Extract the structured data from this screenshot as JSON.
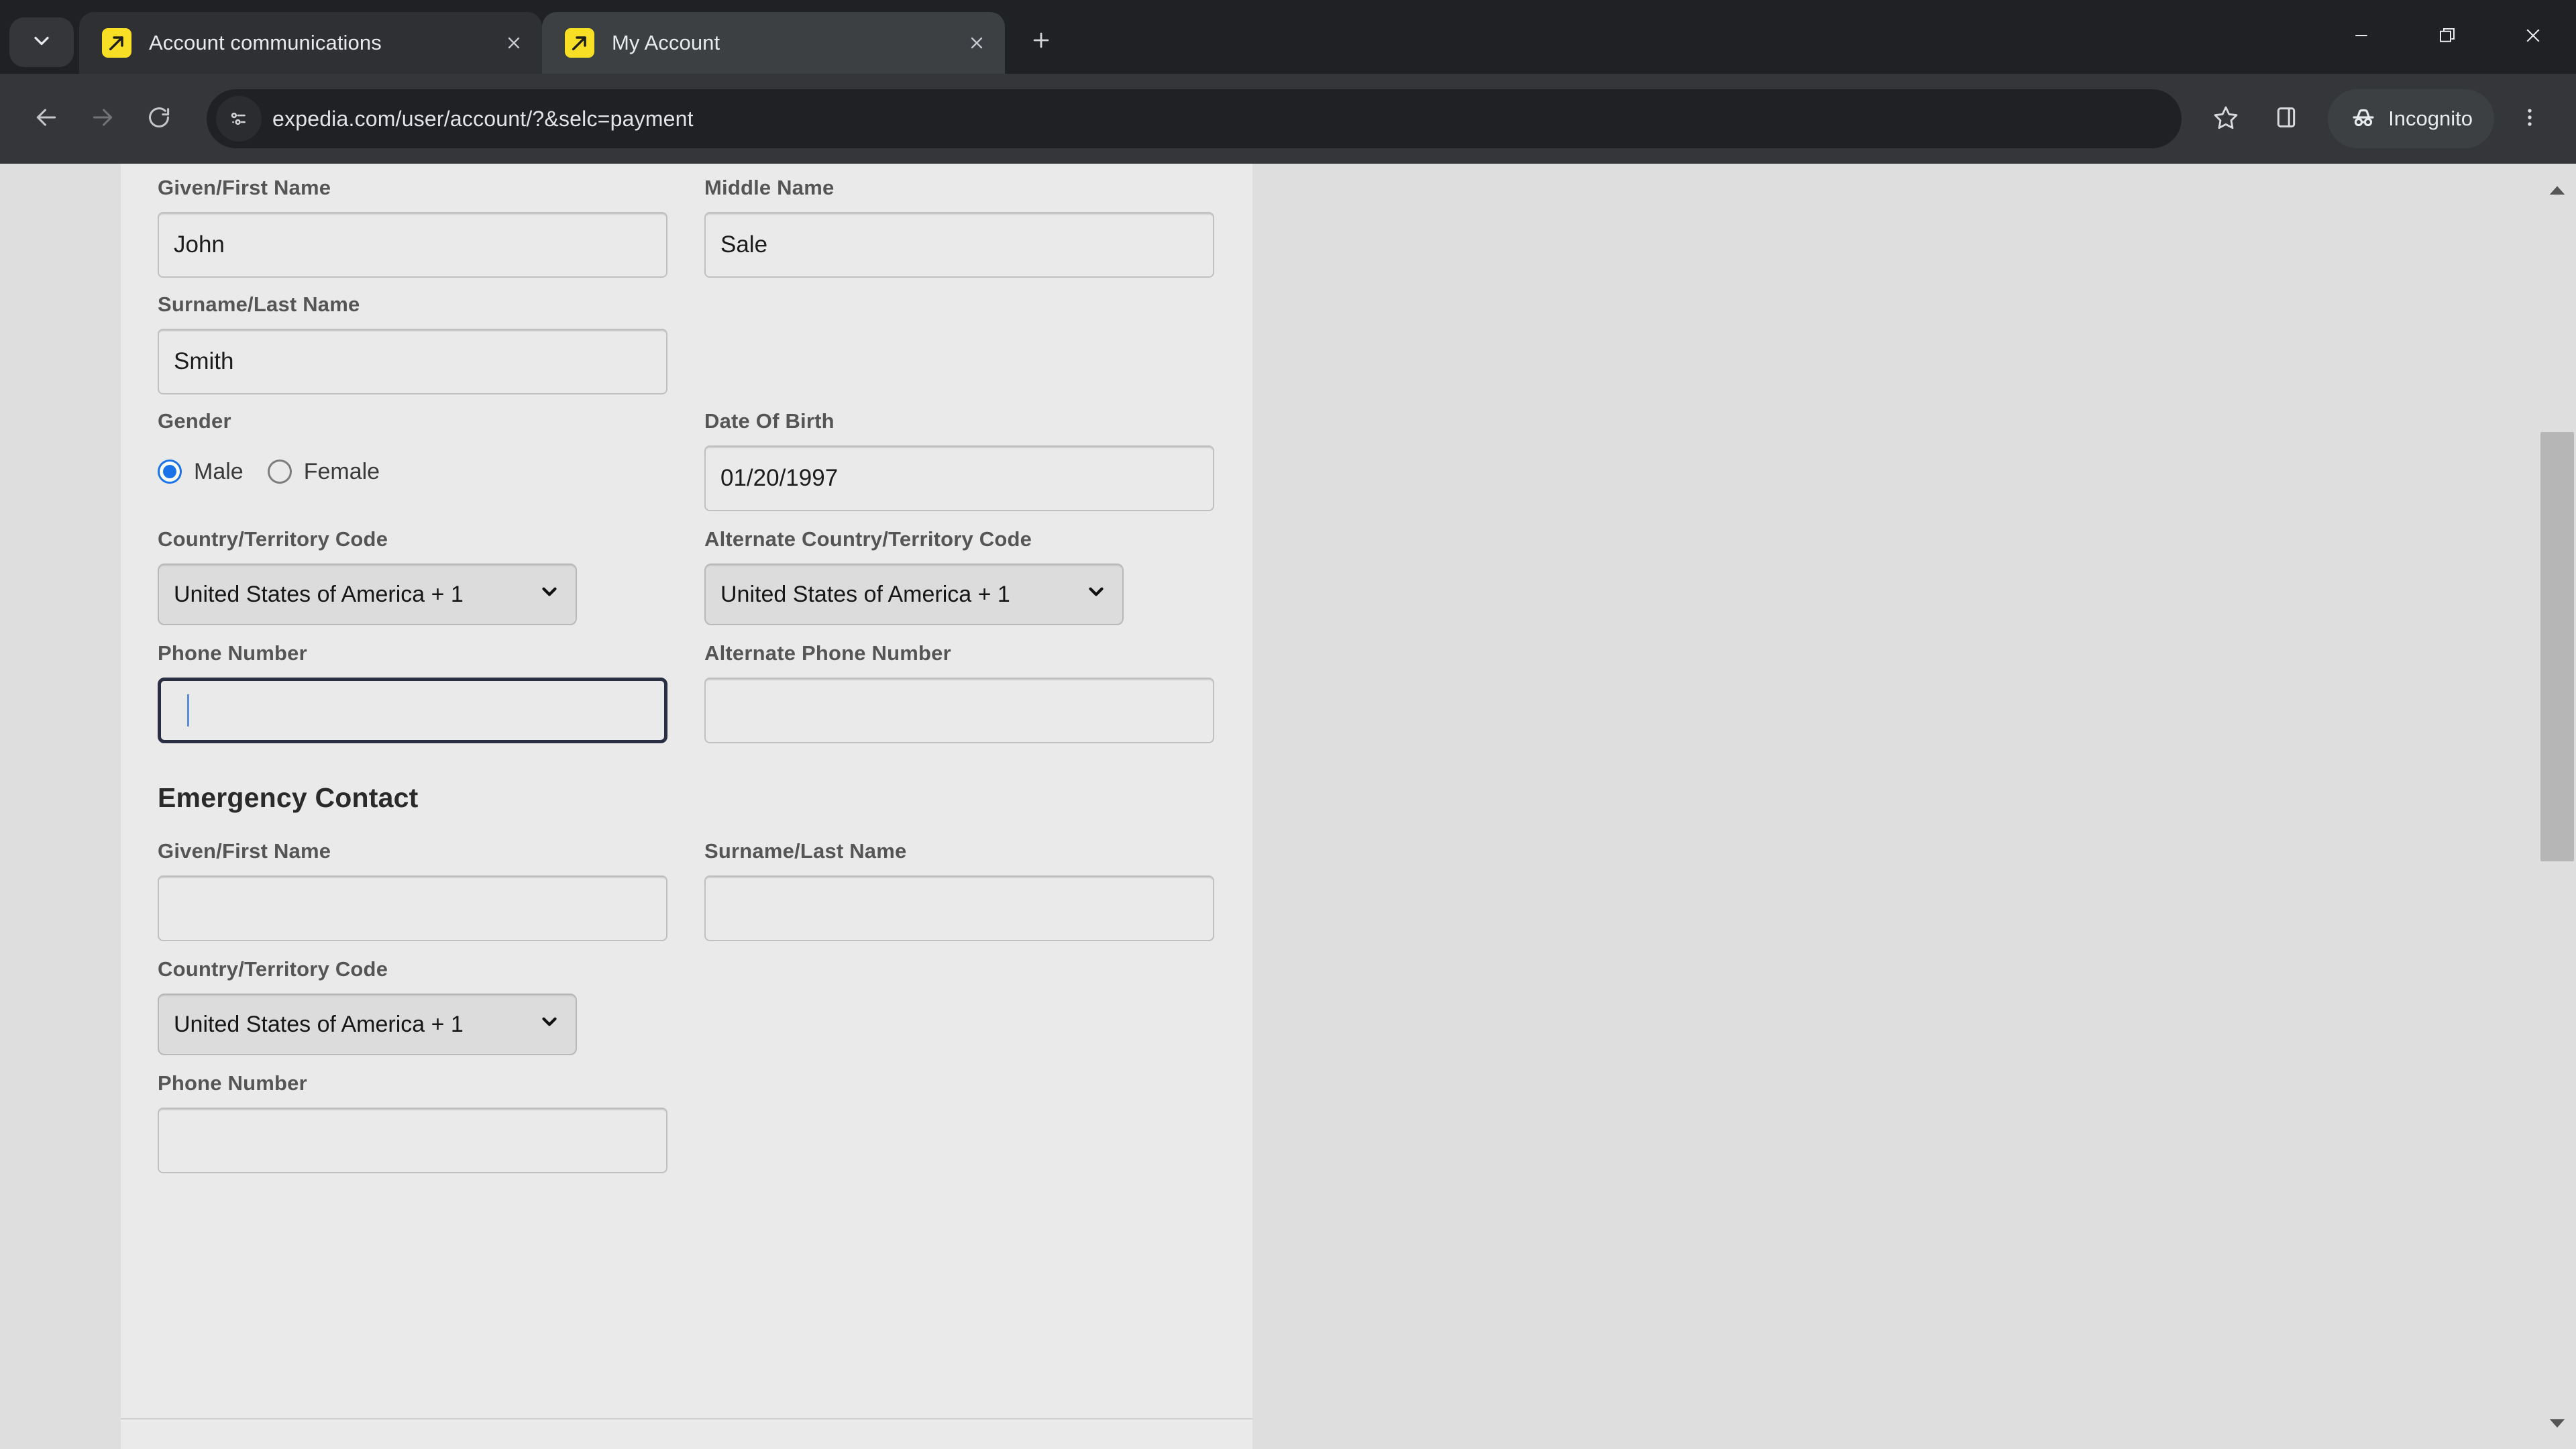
{
  "browser": {
    "tab_search_icon": "chevron-down-icon",
    "tabs": [
      {
        "title": "Account communications",
        "favicon": "expedia-favicon",
        "active": false,
        "close_icon": "close-icon"
      },
      {
        "title": "My Account",
        "favicon": "expedia-favicon",
        "active": true,
        "close_icon": "close-icon"
      }
    ],
    "new_tab_icon": "plus-icon",
    "window_controls": {
      "minimize_icon": "minimize-icon",
      "restore_icon": "restore-icon",
      "close_icon": "close-window-icon"
    },
    "toolbar": {
      "back_icon": "arrow-left-icon",
      "forward_icon": "arrow-right-icon",
      "reload_icon": "reload-icon",
      "site_info_icon": "page-info-icon",
      "url": "expedia.com/user/account/?&selc=payment",
      "url_placeholder": "Search Google or type a URL",
      "bookmark_icon": "star-icon",
      "side_panel_icon": "side-panel-icon",
      "incognito_icon": "incognito-icon",
      "incognito_label": "Incognito",
      "menu_icon": "three-dots-vertical-icon"
    }
  },
  "page": {
    "traveler": {
      "given_name": {
        "label": "Given/First Name",
        "value": "John",
        "placeholder": ""
      },
      "middle_name": {
        "label": "Middle Name",
        "value": "Sale",
        "placeholder": ""
      },
      "surname": {
        "label": "Surname/Last Name",
        "value": "Smith",
        "placeholder": ""
      },
      "gender": {
        "label": "Gender",
        "options": [
          {
            "label": "Male",
            "selected": true
          },
          {
            "label": "Female",
            "selected": false
          }
        ]
      },
      "date_of_birth": {
        "label": "Date Of Birth",
        "value": "01/20/1997",
        "placeholder": ""
      },
      "country_code": {
        "label": "Country/Territory Code",
        "value": "United States of America + 1",
        "caret_icon": "chevron-down-icon"
      },
      "alt_country_code": {
        "label": "Alternate Country/Territory Code",
        "value": "United States of America + 1",
        "caret_icon": "chevron-down-icon"
      },
      "phone": {
        "label": "Phone Number",
        "value": "",
        "placeholder": "",
        "focused": true
      },
      "alt_phone": {
        "label": "Alternate Phone Number",
        "value": "",
        "placeholder": ""
      }
    },
    "emergency_contact": {
      "heading": "Emergency Contact",
      "given_name": {
        "label": "Given/First Name",
        "value": "",
        "placeholder": ""
      },
      "surname": {
        "label": "Surname/Last Name",
        "value": "",
        "placeholder": ""
      },
      "country_code": {
        "label": "Country/Territory Code",
        "value": "United States of America + 1",
        "caret_icon": "chevron-down-icon"
      },
      "phone": {
        "label": "Phone Number",
        "value": "",
        "placeholder": ""
      }
    },
    "scrollbar": {
      "up_arrow_icon": "scroll-up-arrow-icon",
      "down_arrow_icon": "scroll-down-arrow-icon"
    }
  },
  "colors": {
    "chrome_bg": "#202124",
    "toolbar_bg": "#35363a",
    "active_tab": "#3c4043",
    "favicon_yellow": "#f8df26",
    "page_bg": "#eaeaea",
    "outer_bg": "#dedede",
    "focus_border": "#2b2f43",
    "radio_accent": "#1a73e8",
    "caret": "#5b8dd9"
  }
}
